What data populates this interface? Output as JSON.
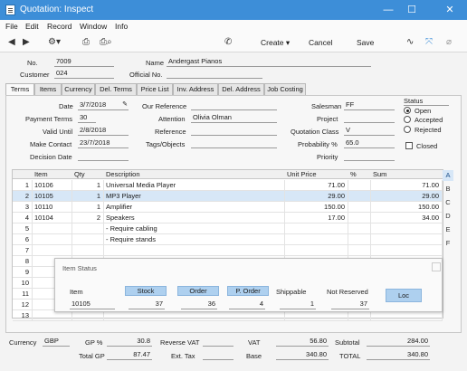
{
  "window": {
    "title": "Quotation: Inspect",
    "close_glyph": "✕",
    "max_glyph": "☐",
    "min_glyph": "—"
  },
  "menu": [
    "File",
    "Edit",
    "Record",
    "Window",
    "Info"
  ],
  "toolbar": {
    "create": "Create",
    "cancel": "Cancel",
    "save": "Save"
  },
  "header": {
    "no_label": "No.",
    "no_value": "7009",
    "name_label": "Name",
    "name_value": "Andergast Pianos",
    "customer_label": "Customer",
    "customer_value": "024",
    "official_label": "Official No.",
    "official_value": ""
  },
  "tabs": [
    "Terms",
    "Items",
    "Currency",
    "Del. Terms",
    "Price List",
    "Inv. Address",
    "Del. Address",
    "Job Costing"
  ],
  "terms": {
    "date_label": "Date",
    "date_value": "3/7/2018",
    "payterms_label": "Payment Terms",
    "payterms_value": "30",
    "valid_label": "Valid Until",
    "valid_value": "2/8/2018",
    "contact_label": "Make Contact",
    "contact_value": "23/7/2018",
    "decision_label": "Decision Date",
    "decision_value": "",
    "ourref_label": "Our Reference",
    "ourref_value": "",
    "attention_label": "Attention",
    "attention_value": "Olivia Olman",
    "reference_label": "Reference",
    "reference_value": "",
    "tags_label": "Tags/Objects",
    "tags_value": "",
    "salesman_label": "Salesman",
    "salesman_value": "FF",
    "project_label": "Project",
    "project_value": "",
    "qclass_label": "Quotation Class",
    "qclass_value": "V",
    "prob_label": "Probability %",
    "prob_value": "65.0",
    "priority_label": "Priority",
    "priority_value": ""
  },
  "status": {
    "title": "Status",
    "open": "Open",
    "accepted": "Accepted",
    "rejected": "Rejected",
    "closed": "Closed",
    "selected": "Open"
  },
  "grid": {
    "headers": [
      "Item",
      "Qty",
      "Description",
      "Unit Price",
      "%",
      "Sum"
    ],
    "rows": [
      {
        "no": "1",
        "item": "10106",
        "qty": "1",
        "desc": "Universal Media Player",
        "price": "71.00",
        "pct": "",
        "sum": "71.00"
      },
      {
        "no": "2",
        "item": "10105",
        "qty": "1",
        "desc": "MP3 Player",
        "price": "29.00",
        "pct": "",
        "sum": "29.00"
      },
      {
        "no": "3",
        "item": "10110",
        "qty": "1",
        "desc": "Amplifier",
        "price": "150.00",
        "pct": "",
        "sum": "150.00"
      },
      {
        "no": "4",
        "item": "10104",
        "qty": "2",
        "desc": "Speakers",
        "price": "17.00",
        "pct": "",
        "sum": "34.00"
      },
      {
        "no": "5",
        "item": "",
        "qty": "",
        "desc": "- Require cabling",
        "price": "",
        "pct": "",
        "sum": ""
      },
      {
        "no": "6",
        "item": "",
        "qty": "",
        "desc": "- Require stands",
        "price": "",
        "pct": "",
        "sum": ""
      },
      {
        "no": "7",
        "item": "",
        "qty": "",
        "desc": "",
        "price": "",
        "pct": "",
        "sum": ""
      },
      {
        "no": "8",
        "item": "",
        "qty": "",
        "desc": "",
        "price": "",
        "pct": "",
        "sum": ""
      },
      {
        "no": "9",
        "item": "",
        "qty": "",
        "desc": "",
        "price": "",
        "pct": "",
        "sum": ""
      },
      {
        "no": "10",
        "item": "",
        "qty": "",
        "desc": "",
        "price": "",
        "pct": "",
        "sum": ""
      },
      {
        "no": "11",
        "item": "",
        "qty": "",
        "desc": "",
        "price": "",
        "pct": "",
        "sum": ""
      },
      {
        "no": "12",
        "item": "",
        "qty": "",
        "desc": "",
        "price": "",
        "pct": "",
        "sum": ""
      },
      {
        "no": "13",
        "item": "",
        "qty": "",
        "desc": "",
        "price": "",
        "pct": "",
        "sum": ""
      }
    ],
    "side_tabs": [
      "A",
      "B",
      "C",
      "D",
      "E",
      "F"
    ]
  },
  "item_status": {
    "title": "Item Status",
    "item_label": "Item",
    "item_value": "10105",
    "stock_label": "Stock",
    "stock_value": "37",
    "order_label": "Order",
    "order_value": "36",
    "porder_label": "P. Order",
    "porder_value": "4",
    "ship_label": "Shippable",
    "ship_value": "1",
    "notres_label": "Not Reserved",
    "notres_value": "37",
    "loc_label": "Loc"
  },
  "footer": {
    "currency_label": "Currency",
    "currency_value": "GBP",
    "gp_pct_label": "GP %",
    "gp_pct_value": "30.8",
    "total_gp_label": "Total GP",
    "total_gp_value": "87.47",
    "reverse_vat_label": "Reverse VAT",
    "reverse_vat_value": "",
    "ext_tax_label": "Ext. Tax",
    "ext_tax_value": "",
    "vat_label": "VAT",
    "vat_value": "56.80",
    "base_label": "Base",
    "base_value": "340.80",
    "subtotal_label": "Subtotal",
    "subtotal_value": "284.00",
    "total_label": "TOTAL",
    "total_value": "340.80"
  }
}
